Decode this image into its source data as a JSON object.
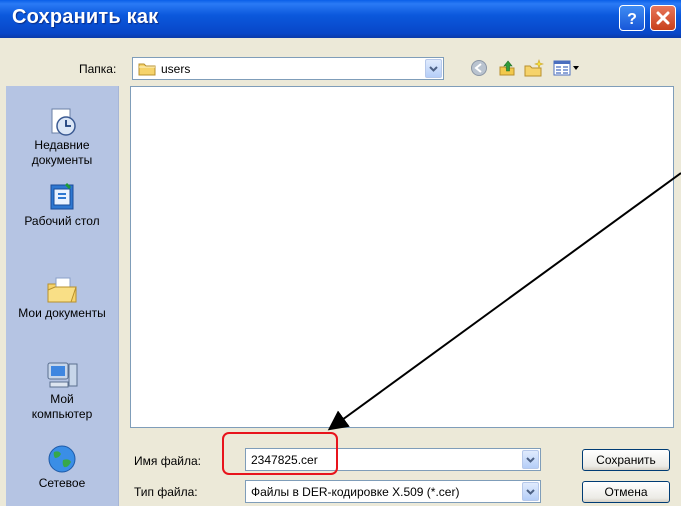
{
  "window": {
    "title": "Сохранить как"
  },
  "folder": {
    "label": "Папка:",
    "current": "users"
  },
  "places": [
    {
      "label": "Недавние\nдокументы",
      "icon": "recent-documents-icon"
    },
    {
      "label": "Рабочий стол",
      "icon": "desktop-icon"
    },
    {
      "label": "Мои документы",
      "icon": "my-documents-icon"
    },
    {
      "label": "Мой\nкомпьютер",
      "icon": "my-computer-icon"
    },
    {
      "label": "Сетевое",
      "icon": "network-icon"
    }
  ],
  "filename": {
    "label": "Имя файла:",
    "value": "2347825.cer"
  },
  "filetype": {
    "label": "Тип файла:",
    "value": "Файлы в DER-кодировке X.509 (*.cer)"
  },
  "buttons": {
    "save": "Сохранить",
    "cancel": "Отмена"
  },
  "colors": {
    "titlebar": "#0a56d8",
    "places_bar": "#b5c4e3",
    "highlight": "#e8141c",
    "dialog_bg": "#ece9d8"
  }
}
